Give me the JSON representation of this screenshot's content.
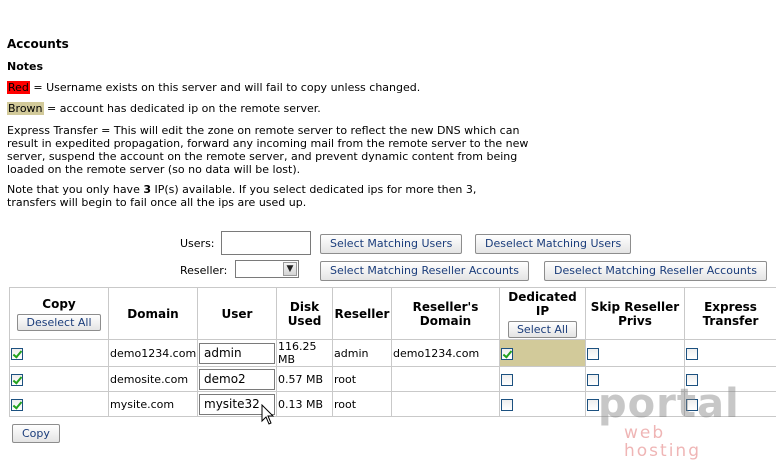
{
  "page": {
    "title": "Accounts",
    "notes_heading": "Notes"
  },
  "notes": {
    "red_label": "Red",
    "red_text": " = Username exists on this server and will fail to copy unless changed.",
    "brown_label": "Brown",
    "brown_text": " = account has dedicated ip on the remote server.",
    "express_transfer": "Express Transfer = This will edit the zone on remote server to reflect the new DNS which can result in expedited propagation, forward any incoming mail from the remote server to the new server, suspend the account on the remote server, and prevent dynamic content from being loaded on the remote server (so no data will be lost).",
    "ip_prefix": "Note that you only have ",
    "ip_count": "3",
    "ip_suffix": " IP(s) available. If you select dedicated ips for more then 3, transfers will begin to fail once all the ips are used up."
  },
  "filters": {
    "users_label": "Users:",
    "users_value": "",
    "select_matching_users": "Select Matching Users",
    "deselect_matching_users": "Deselect Matching Users",
    "reseller_label": "Reseller:",
    "reseller_value": "",
    "select_matching_reseller": "Select Matching Reseller Accounts",
    "deselect_matching_reseller": "Deselect Matching Reseller Accounts"
  },
  "table": {
    "headers": {
      "copy": "Copy",
      "deselect_all": "Deselect All",
      "domain": "Domain",
      "user": "User",
      "disk_used": "Disk Used",
      "reseller": "Reseller",
      "resellers_domain": "Reseller's Domain",
      "dedicated_ip": "Dedicated IP",
      "select_all": "Select All",
      "skip_reseller_privs": "Skip Reseller Privs",
      "express_transfer": "Express Transfer"
    },
    "rows": [
      {
        "copy": true,
        "domain": "demo1234.com",
        "user": "admin",
        "disk": "116.25 MB",
        "reseller": "admin",
        "reseller_domain": "demo1234.com",
        "dedicated_ip": true,
        "skip_privs": false,
        "express": false
      },
      {
        "copy": true,
        "domain": "demosite.com",
        "user": "demo2",
        "disk": "0.57 MB",
        "reseller": "root",
        "reseller_domain": "",
        "dedicated_ip": false,
        "skip_privs": false,
        "express": false
      },
      {
        "copy": true,
        "domain": "mysite.com",
        "user": "mysite32",
        "disk": "0.13 MB",
        "reseller": "root",
        "reseller_domain": "",
        "dedicated_ip": false,
        "skip_privs": false,
        "express": false
      }
    ]
  },
  "copy_button": "Copy",
  "watermark": {
    "brand": "portal",
    "sub": "web hosting"
  },
  "colors": {
    "red_highlight": "#ff0000",
    "brown_highlight": "#d2ca9a",
    "checkmark": "#22a21f",
    "button_text": "#1a3c7a"
  }
}
